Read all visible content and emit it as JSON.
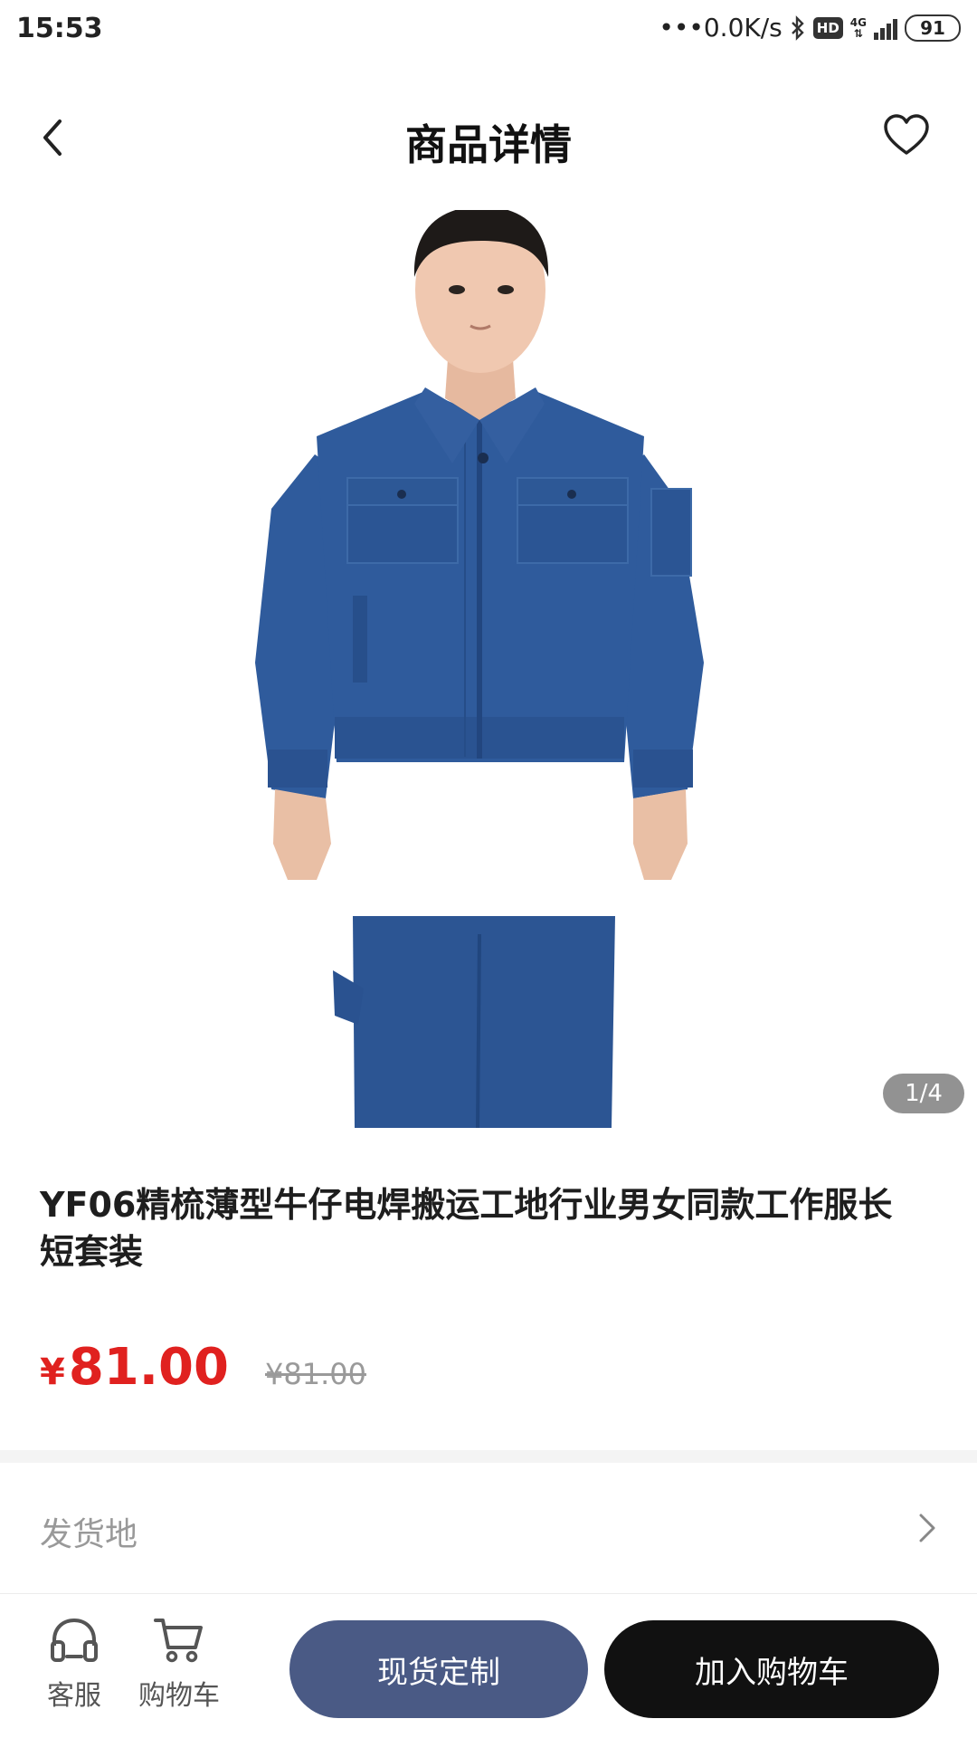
{
  "status_bar": {
    "time": "15:53",
    "net_speed": "•••0.0K/s",
    "hd_label": "HD",
    "network_type": "4G",
    "battery": "91"
  },
  "nav": {
    "title": "商品详情",
    "back_icon": "chevron-left-icon",
    "favorite_icon": "heart-outline-icon"
  },
  "gallery": {
    "counter": "1/4",
    "image_subject": "man in blue denim work jacket and trousers"
  },
  "product": {
    "title": "YF06精梳薄型牛仔电焊搬运工地行业男女同款工作服长短套装",
    "currency": "¥",
    "price": "81.00",
    "original_price": "¥81.00"
  },
  "shipping": {
    "label": "发货地"
  },
  "bottom_bar": {
    "service_label": "客服",
    "cart_label": "购物车",
    "custom_button": "现货定制",
    "add_to_cart_button": "加入购物车"
  },
  "colors": {
    "price_red": "#e0211f",
    "custom_button_bg": "#4a5a85",
    "cart_button_bg": "#111111"
  }
}
